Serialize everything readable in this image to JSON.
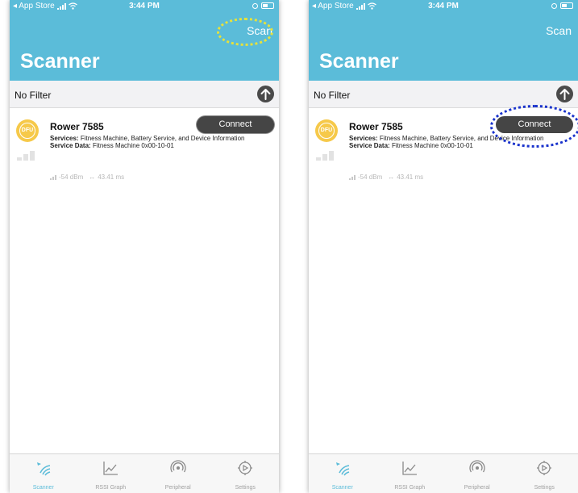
{
  "colors": {
    "header": "#5bbcd9",
    "connect_button": "#454545",
    "dfu_badge": "#f6c94a",
    "scan_highlight": "#e8e23a",
    "connect_highlight": "#1a33cc"
  },
  "phones": [
    {
      "status": {
        "carrier": "◂ App Store",
        "time": "3:44 PM"
      },
      "scan_label": "Scan",
      "title": "Scanner",
      "filter_label": "No Filter",
      "device": {
        "icon": "dfu-icon",
        "icon_text": "DFU",
        "name": "Rower 7585",
        "services_label": "Services:",
        "services_value": "Fitness Machine, Battery Service, and Device Information",
        "service_data_label": "Service Data:",
        "service_data_value": "Fitness Machine 0x00-10-01",
        "rssi": "-54 dBm",
        "interval_icon": "↔",
        "interval": "43.41 ms",
        "connect_label": "Connect"
      },
      "tabs": [
        {
          "label": "Scanner",
          "icon": "scanner-icon",
          "active": true
        },
        {
          "label": "RSSI Graph",
          "icon": "rssi-graph-icon",
          "active": false
        },
        {
          "label": "Peripheral",
          "icon": "peripheral-icon",
          "active": false
        },
        {
          "label": "Settings",
          "icon": "settings-icon",
          "active": false
        }
      ]
    },
    {
      "status": {
        "carrier": "◂ App Store",
        "time": "3:44 PM"
      },
      "scan_label": "Scan",
      "title": "Scanner",
      "filter_label": "No Filter",
      "device": {
        "icon": "dfu-icon",
        "icon_text": "DFU",
        "name": "Rower 7585",
        "services_label": "Services:",
        "services_value": "Fitness Machine, Battery Service, and Device Information",
        "service_data_label": "Service Data:",
        "service_data_value": "Fitness Machine 0x00-10-01",
        "rssi": "-54 dBm",
        "interval_icon": "↔",
        "interval": "43.41 ms",
        "connect_label": "Connect"
      },
      "tabs": [
        {
          "label": "Scanner",
          "icon": "scanner-icon",
          "active": true
        },
        {
          "label": "RSSI Graph",
          "icon": "rssi-graph-icon",
          "active": false
        },
        {
          "label": "Peripheral",
          "icon": "peripheral-icon",
          "active": false
        },
        {
          "label": "Settings",
          "icon": "settings-icon",
          "active": false
        }
      ]
    }
  ],
  "annotations": [
    {
      "name": "scan-highlight",
      "color": "yellow",
      "target": "scan-button"
    },
    {
      "name": "connect-highlight",
      "color": "blue",
      "target": "connect-button"
    }
  ]
}
